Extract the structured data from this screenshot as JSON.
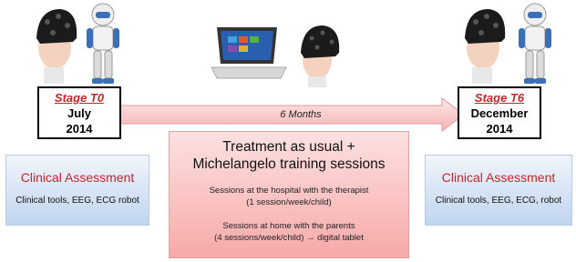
{
  "stage_t0": {
    "title": "Stage T0",
    "month": "July",
    "year": "2014"
  },
  "stage_t6": {
    "title": "Stage T6",
    "month": "December",
    "year": "2014"
  },
  "arrow_label": "6 Months",
  "clinical_left": {
    "title": "Clinical Assessment",
    "subtitle": "Clinical tools, EEG, ECG robot"
  },
  "clinical_right": {
    "title": "Clinical Assessment",
    "subtitle": "Clinical tools, EEG, ECG, robot"
  },
  "treatment": {
    "title_line1": "Treatment as usual +",
    "title_line2": "Michelangelo training sessions",
    "hospital_line1": "Sessions at the hospital with the therapist",
    "hospital_line2": "(1 session/week/child)",
    "home_line1": "Sessions at home with the parents",
    "home_line2": "(4 sessions/week/child) → digital tablet"
  },
  "colors": {
    "accent_red": "#c0282a",
    "arrow_fill": "#f9c6c6",
    "clinical_blue": "#c9dcf2",
    "treatment_pink": "#f9b8b8"
  },
  "icons": [
    "child-eeg-cap-icon",
    "humanoid-robot-icon",
    "tablet-computer-icon"
  ]
}
